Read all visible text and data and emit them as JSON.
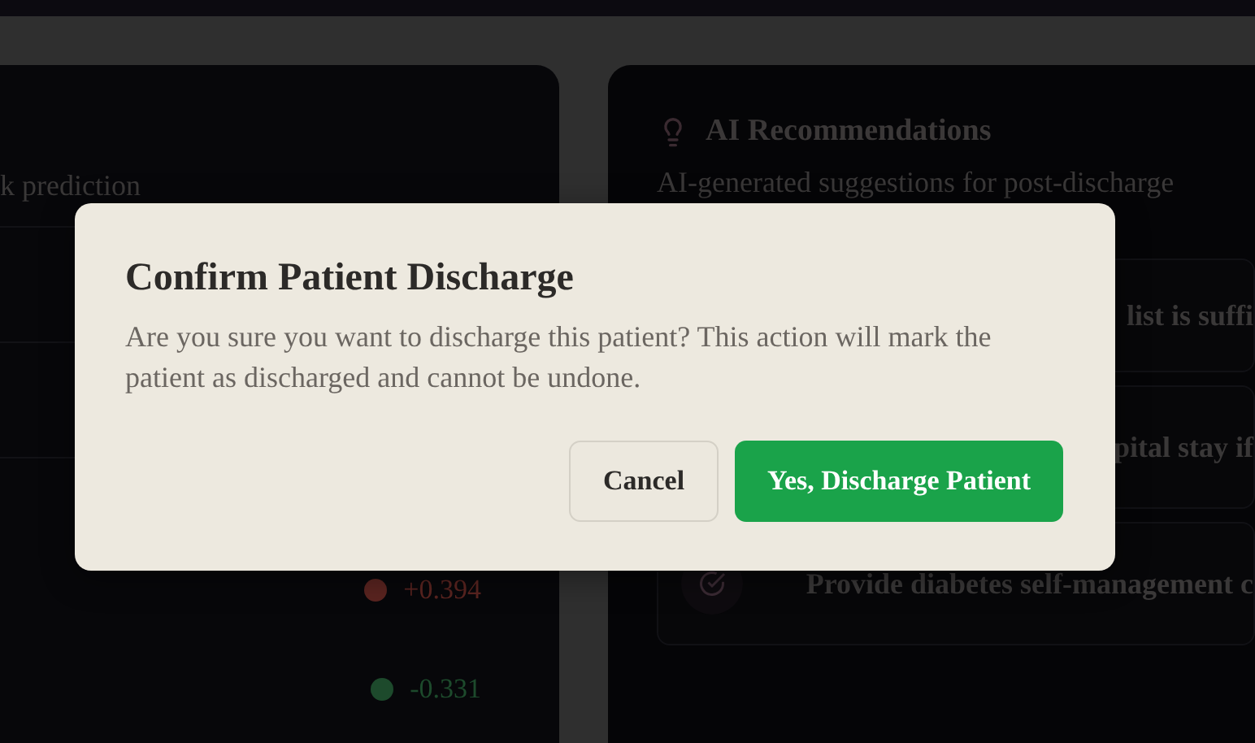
{
  "left_card": {
    "subtitle": "k prediction",
    "factors": [
      {
        "value": "+0.394",
        "color": "#5a2420"
      },
      {
        "value": "-0.331",
        "color": "#1d4a2c"
      }
    ]
  },
  "right_card": {
    "title": "AI Recommendations",
    "subtitle": "AI-generated suggestions for post-discharge",
    "items": [
      {
        "kind": "covered",
        "text": "list is suffi"
      },
      {
        "kind": "covered",
        "text": "pital stay if"
      },
      {
        "kind": "full",
        "text": "Provide diabetes self-management c"
      }
    ]
  },
  "dialog": {
    "title": "Confirm Patient Discharge",
    "message": "Are you sure you want to discharge this patient? This action will mark the patient as discharged and cannot be undone.",
    "buttons": [
      {
        "kind": "secondary",
        "label": "Cancel"
      },
      {
        "kind": "primary",
        "label": "Yes, Discharge Patient"
      }
    ]
  }
}
